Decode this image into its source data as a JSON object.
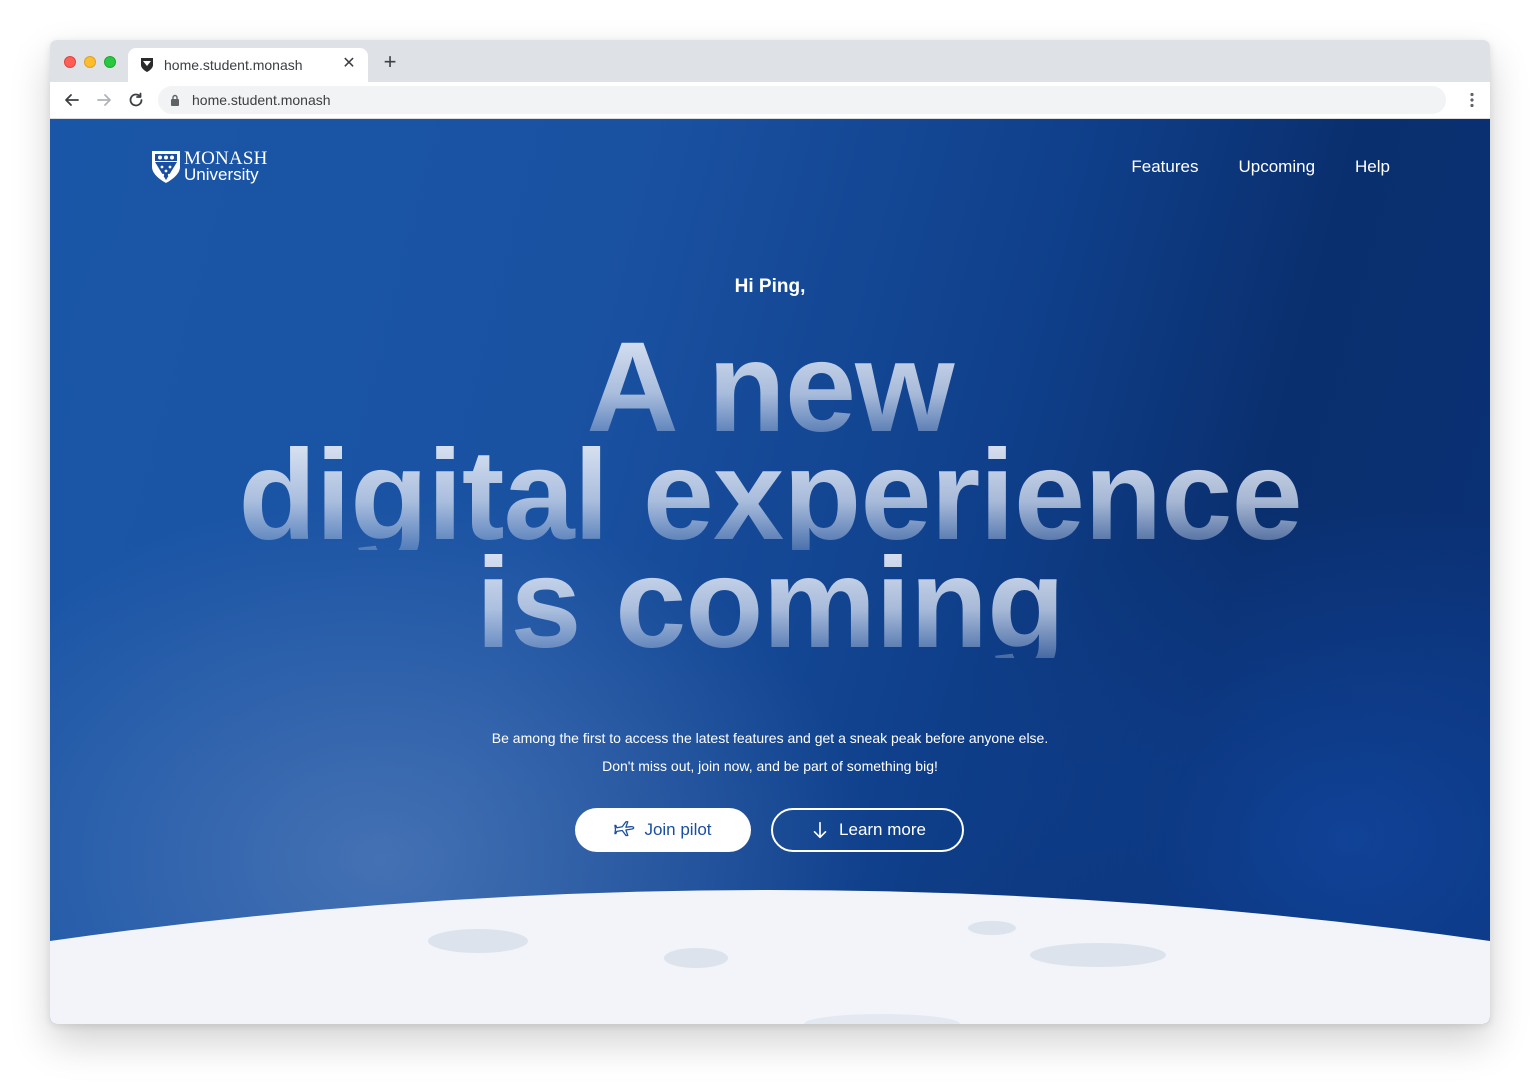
{
  "browser": {
    "tab_title": "home.student.monash",
    "tab_close": "✕",
    "new_tab": "+",
    "url": "home.student.monash"
  },
  "site": {
    "logo_line1": "MONASH",
    "logo_line2": "University",
    "nav": [
      "Features",
      "Upcoming",
      "Help"
    ]
  },
  "hero": {
    "greeting": "Hi Ping,",
    "headline": [
      "A new",
      "digital experience",
      "is coming"
    ],
    "sub_line1": "Be among the first to access the latest features and get a sneak peak before anyone else.",
    "sub_line2": "Don't miss out, join now, and be part of something big!",
    "join_label": "Join pilot",
    "learn_label": "Learn more"
  },
  "colors": {
    "brand_blue": "#1a4fa0",
    "moon_surface": "#f2f4f9"
  }
}
